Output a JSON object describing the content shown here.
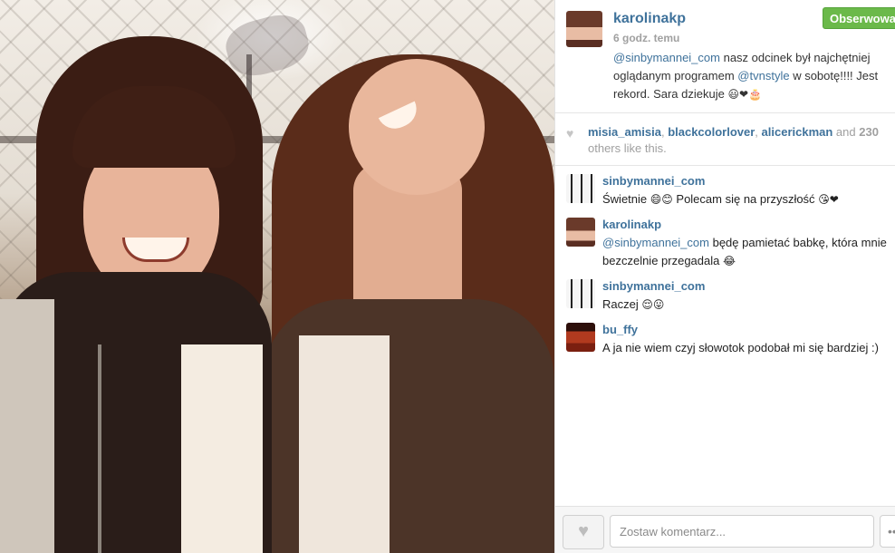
{
  "post": {
    "username": "karolinakp",
    "time": "6 godz. temu",
    "follow_label": "Obserwowane",
    "caption": {
      "mention1": "@sinbymannei_com",
      "text1": " nasz odcinek był najchętniej oglądanym programem ",
      "mention2": "@tvnstyle",
      "text2": " w sobotę!!!! Jest rekord. Sara dziekuje ",
      "emoji": "😃❤🎂"
    }
  },
  "likes": {
    "user1": "misia_amisia",
    "sep1": ", ",
    "user2": "blackcolorlover",
    "sep2": ", ",
    "user3": "alicerickman",
    "and": " and ",
    "count": "230",
    "rest": " others like this."
  },
  "comments": [
    {
      "username": "sinbymannei_com",
      "text": "Świetnie ",
      "emoji1": "😄😊",
      "text2": " Polecam się na przyszłość ",
      "emoji2": "😘❤"
    },
    {
      "username": "karolinakp",
      "mention": "@sinbymannei_com",
      "text": " będę pamietać babkę, która mnie bezczelnie przegadala ",
      "emoji": "😂"
    },
    {
      "username": "sinbymannei_com",
      "text": "Raczej ",
      "emoji": "😌😛"
    },
    {
      "username": "bu_ffy",
      "text": "A ja nie wiem czyj słowotok podobał mi się bardziej :)"
    }
  ],
  "footer": {
    "comment_placeholder": "Zostaw komentarz...",
    "more_label": "•••"
  },
  "icons": {
    "heart": "heart-icon",
    "more": "ellipsis-icon"
  },
  "colors": {
    "link": "#3f729b",
    "follow_green": "#6bb94a",
    "muted": "#a0a0a0"
  }
}
